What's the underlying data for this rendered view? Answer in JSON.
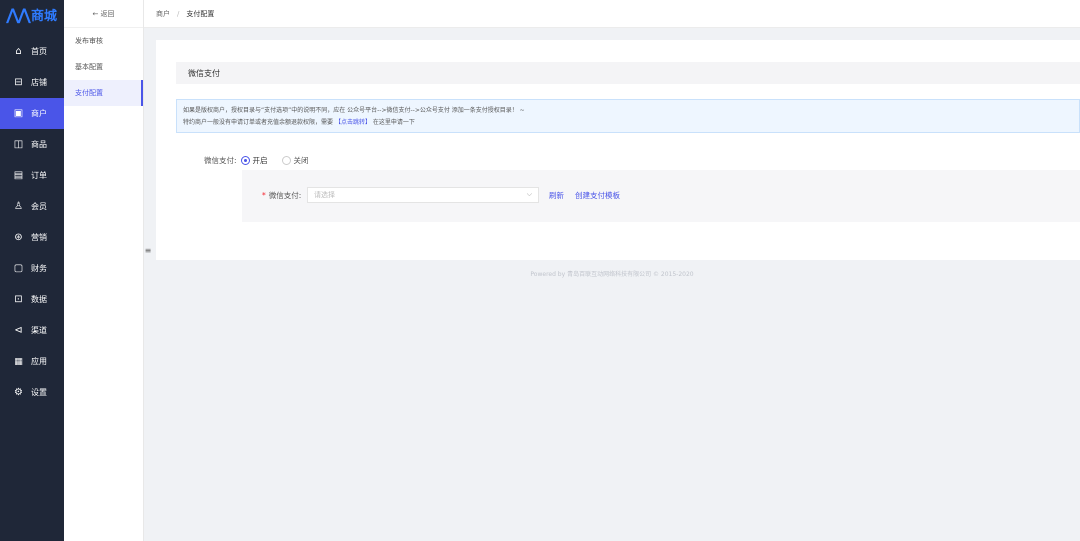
{
  "app": {
    "logo_mark": "⋀⋀",
    "logo_text": "商城"
  },
  "sidebar": {
    "items": [
      {
        "label": "首页",
        "icon": "home-icon",
        "glyph": "⌂"
      },
      {
        "label": "店铺",
        "icon": "store-icon",
        "glyph": "⊟"
      },
      {
        "label": "商户",
        "icon": "merchant-icon",
        "glyph": "▣",
        "active": true
      },
      {
        "label": "商品",
        "icon": "goods-icon",
        "glyph": "◫"
      },
      {
        "label": "订单",
        "icon": "order-icon",
        "glyph": "▤"
      },
      {
        "label": "会员",
        "icon": "member-icon",
        "glyph": "♙"
      },
      {
        "label": "营销",
        "icon": "marketing-icon",
        "glyph": "⊛"
      },
      {
        "label": "财务",
        "icon": "finance-icon",
        "glyph": "▢"
      },
      {
        "label": "数据",
        "icon": "data-icon",
        "glyph": "⊡"
      },
      {
        "label": "渠道",
        "icon": "channel-icon",
        "glyph": "⊲"
      },
      {
        "label": "应用",
        "icon": "apps-icon",
        "glyph": "▦"
      },
      {
        "label": "设置",
        "icon": "settings-icon",
        "glyph": "⚙"
      }
    ]
  },
  "subnav": {
    "back_label": "← 返回",
    "items": [
      {
        "label": "发布审核"
      },
      {
        "label": "基本配置"
      },
      {
        "label": "支付配置",
        "active": true
      }
    ],
    "collapse_glyph": "≡"
  },
  "breadcrumb": {
    "parent": "商户",
    "separator": "/",
    "current": "支付配置"
  },
  "card": {
    "title": "微信支付",
    "notice_line1_a": "如果是版权商户，授权目录与“支付选项”中的说明不同，应在 公众号平台-->微信支付-->公众号支付 添加一条支付授权目录！ ~",
    "notice_line2_a": "特约商户一般没有申请订单或者充值余额退款权限，需要",
    "notice_line2_link": "【点击跳转】",
    "notice_line2_b": "在这里申请一下"
  },
  "wechat_pay": {
    "switch_label": "微信支付:",
    "on_label": "开启",
    "off_label": "关闭",
    "enabled": true,
    "select_label": "微信支付:",
    "select_placeholder": "请选择",
    "refresh_label": "刷新",
    "create_template_label": "创建支付模板"
  },
  "footer": {
    "text": "Powered by 青岛百联互动网络科技有限公司 © 2015-2020"
  },
  "colors": {
    "sidebar_bg": "#1f2738",
    "accent": "#4a55e8",
    "brand": "#2f7bff"
  }
}
